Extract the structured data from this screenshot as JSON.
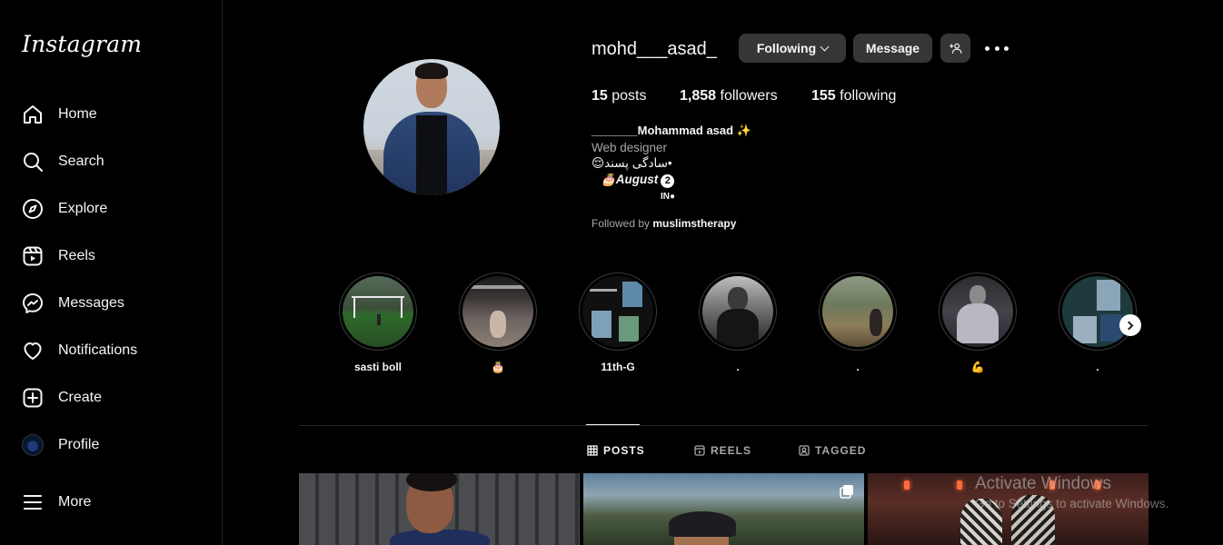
{
  "app": {
    "logo": "Instagram"
  },
  "sidebar": {
    "items": [
      {
        "label": "Home",
        "icon": "home-icon"
      },
      {
        "label": "Search",
        "icon": "search-icon"
      },
      {
        "label": "Explore",
        "icon": "compass-icon"
      },
      {
        "label": "Reels",
        "icon": "reels-icon"
      },
      {
        "label": "Messages",
        "icon": "messenger-icon"
      },
      {
        "label": "Notifications",
        "icon": "heart-icon"
      },
      {
        "label": "Create",
        "icon": "plus-square-icon"
      },
      {
        "label": "Profile",
        "icon": "avatar"
      },
      {
        "label": "More",
        "icon": "hamburger-icon"
      }
    ]
  },
  "profile": {
    "username": "mohd___asad_",
    "following_label": "Following",
    "message_label": "Message",
    "stats": {
      "posts_count": "15",
      "posts_label": " posts",
      "followers_count": "1,858",
      "followers_label": " followers",
      "following_count": "155",
      "following_label": " following"
    },
    "bio": {
      "name": "_______Mohammad asad ✨",
      "category": "Web designer",
      "line1": "😌سادگی پسند•",
      "line2": "🎂August",
      "line2_badge": "2",
      "line3": "IN●"
    },
    "followed_by_prefix": "Followed by ",
    "followed_by_user": "muslimstherapy"
  },
  "highlights": [
    {
      "caption": "sasti boll"
    },
    {
      "caption": "🎂"
    },
    {
      "caption": "11th-G"
    },
    {
      "caption": "."
    },
    {
      "caption": "."
    },
    {
      "caption": "💪"
    },
    {
      "caption": "."
    }
  ],
  "tabs": [
    {
      "label": "POSTS",
      "active": true
    },
    {
      "label": "REELS",
      "active": false
    },
    {
      "label": "TAGGED",
      "active": false
    }
  ],
  "watermark": {
    "title": "Activate Windows",
    "subtitle": "Go to Settings to activate Windows."
  }
}
